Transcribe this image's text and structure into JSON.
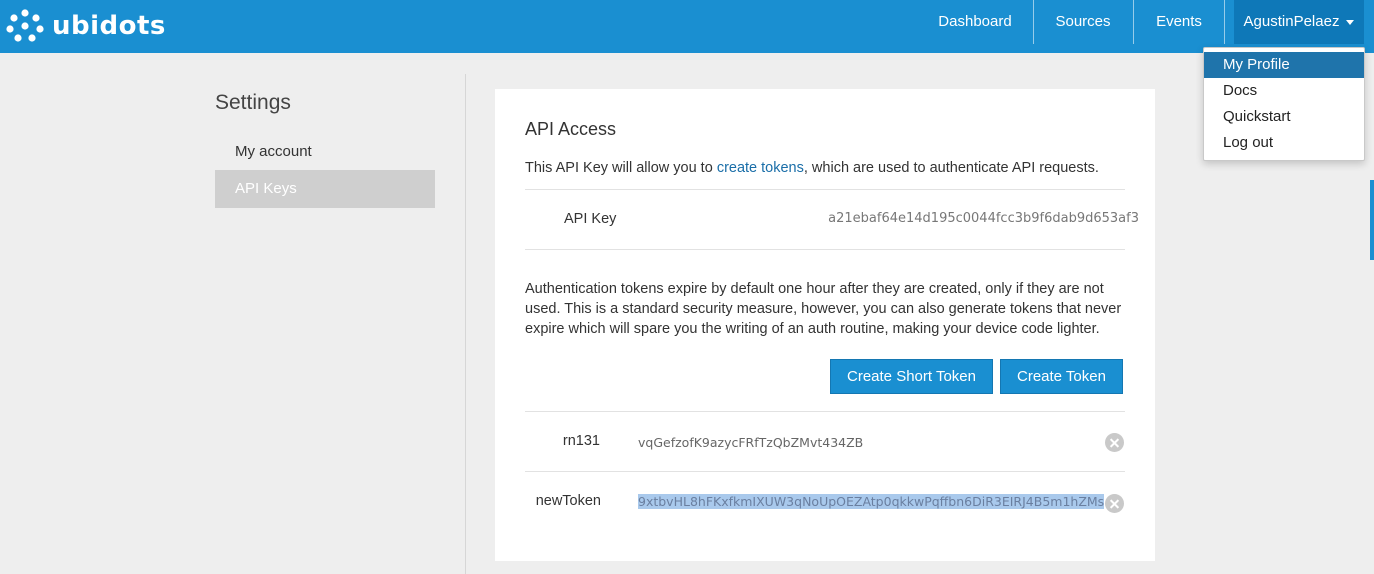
{
  "brand": {
    "name": "ubidots",
    "color": "#1a8fd1"
  },
  "nav": {
    "items": [
      "Dashboard",
      "Sources",
      "Events"
    ],
    "user": "AgustinPelaez"
  },
  "user_menu": [
    "My Profile",
    "Docs",
    "Quickstart",
    "Log out"
  ],
  "sidebar": {
    "title": "Settings",
    "items": [
      {
        "label": "My account",
        "active": false
      },
      {
        "label": "API Keys",
        "active": true
      }
    ]
  },
  "api": {
    "title": "API Access",
    "intro_before": "This API Key will allow you to ",
    "intro_link": "create tokens",
    "intro_after": ", which are used to authenticate API requests.",
    "key_label": "API Key",
    "key_value": "a21ebaf64e14d195c0044fcc3b9f6dab9d653af3",
    "paragraph": "Authentication tokens expire by default one hour after they are created, only if they are not used. This is a standard security measure, however, you can also generate tokens that never expire which will spare you the writing of an auth routine, making your device code lighter.",
    "buttons": {
      "short_token": "Create Short Token",
      "token": "Create Token"
    },
    "tokens": [
      {
        "name": "rn131",
        "value": "vqGefzofK9azycFRfTzQbZMvt434ZB",
        "selected": false
      },
      {
        "name": "newToken",
        "value": "9xtbvHL8hFKxfkmIXUW3qNoUpOEZAtp0qkkwPqffbn6DiR3EIRJ4B5m1hZMs",
        "selected": true
      }
    ]
  }
}
